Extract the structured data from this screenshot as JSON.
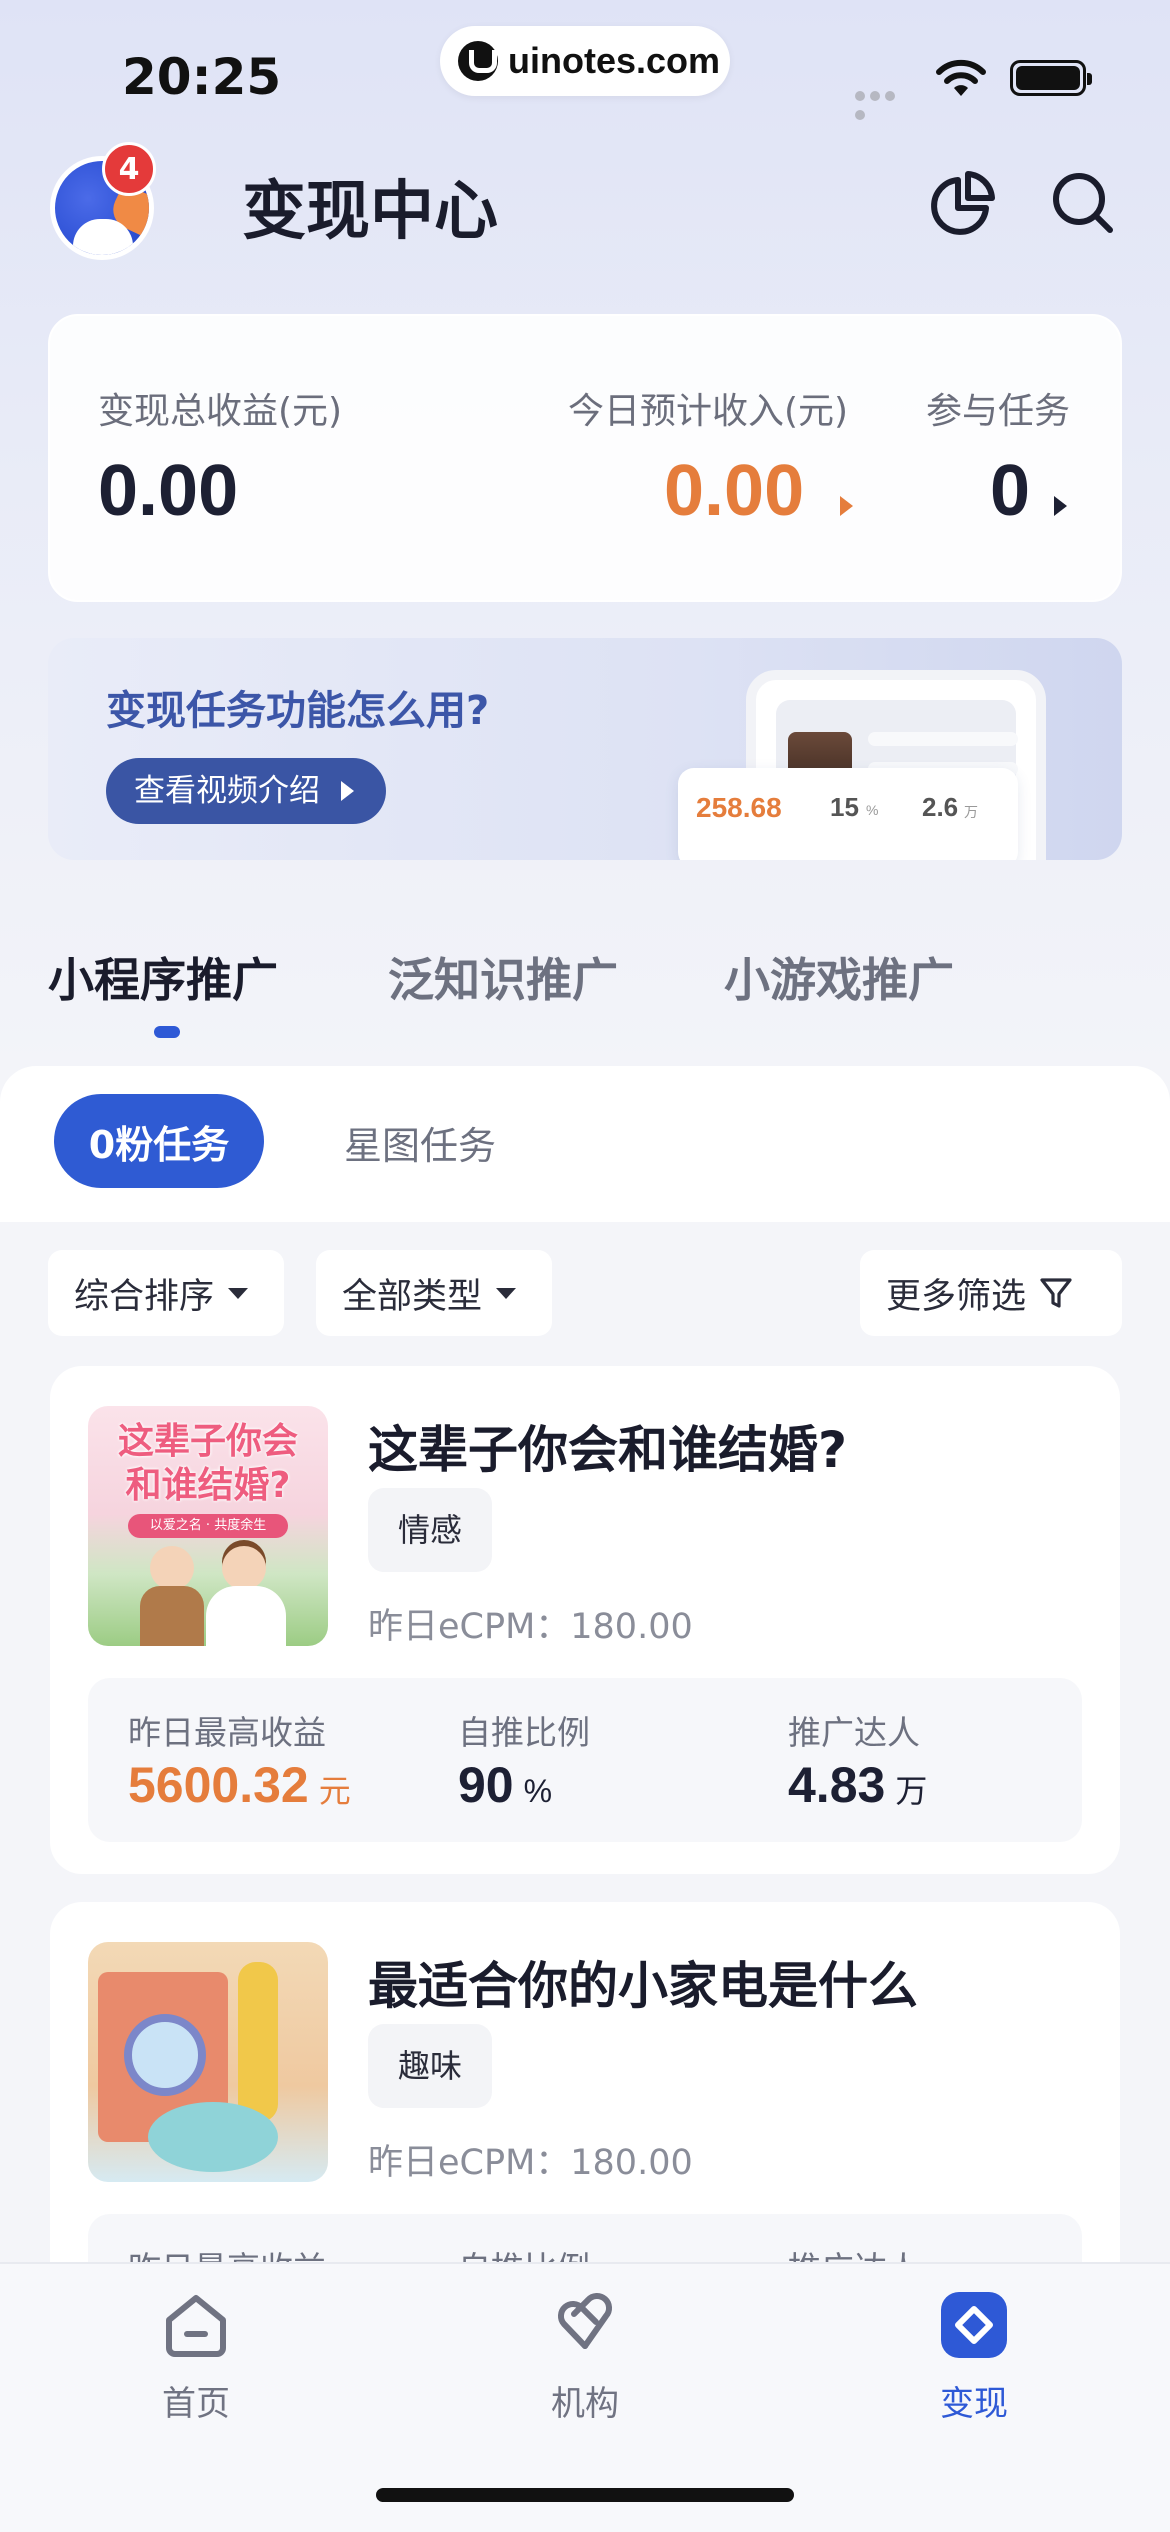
{
  "status_bar": {
    "time": "20:25",
    "url": "uinotes.com"
  },
  "header": {
    "title": "变现中心",
    "badge_count": "4",
    "icons": [
      "pie-chart-icon",
      "search-icon"
    ]
  },
  "summary": {
    "total_label": "变现总收益(元)",
    "total_value": "0.00",
    "today_label": "今日预计收入(元)",
    "today_value": "0.00",
    "tasks_label": "参与任务",
    "tasks_value": "0"
  },
  "banner": {
    "title": "变现任务功能怎么用?",
    "button_label": "查看视频介绍",
    "mock_stat_1": "258.68",
    "mock_stat_2": "15",
    "mock_stat_2_unit": "%",
    "mock_stat_3": "2.6",
    "mock_stat_3_unit": "万"
  },
  "main_tabs": [
    {
      "label": "小程序推广",
      "active": true
    },
    {
      "label": "泛知识推广",
      "active": false
    },
    {
      "label": "小游戏推广",
      "active": false
    }
  ],
  "sub_tabs": [
    {
      "label": "0粉任务",
      "active": true
    },
    {
      "label": "星图任务",
      "active": false
    }
  ],
  "filters": {
    "sort": "综合排序",
    "type": "全部类型",
    "more": "更多筛选"
  },
  "tasks": [
    {
      "title": "这辈子你会和谁结婚?",
      "tag": "情感",
      "ecpm": "昨日eCPM：180.00",
      "thumb_text_1": "这辈子你会",
      "thumb_text_2": "和谁结婚?",
      "thumb_text_3": "以爱之名 · 共度余生",
      "stats": [
        {
          "label": "昨日最高收益",
          "value": "5600.32",
          "unit": "元"
        },
        {
          "label": "自推比例",
          "value": "90",
          "unit": "%"
        },
        {
          "label": "推广达人",
          "value": "4.83",
          "unit": "万"
        }
      ]
    },
    {
      "title": "最适合你的小家电是什么",
      "tag": "趣味",
      "ecpm": "昨日eCPM：180.00",
      "stats": [
        {
          "label": "昨日最高收益"
        },
        {
          "label": "自推比例"
        },
        {
          "label": "推广达人"
        }
      ]
    }
  ],
  "bottom_nav": [
    {
      "label": "首页",
      "icon": "home-icon",
      "active": false
    },
    {
      "label": "机构",
      "icon": "organization-icon",
      "active": false
    },
    {
      "label": "变现",
      "icon": "monetize-icon",
      "active": true
    }
  ],
  "colors": {
    "accent": "#2e59d6",
    "orange": "#e57d3c",
    "text_dark": "#1d2033"
  }
}
